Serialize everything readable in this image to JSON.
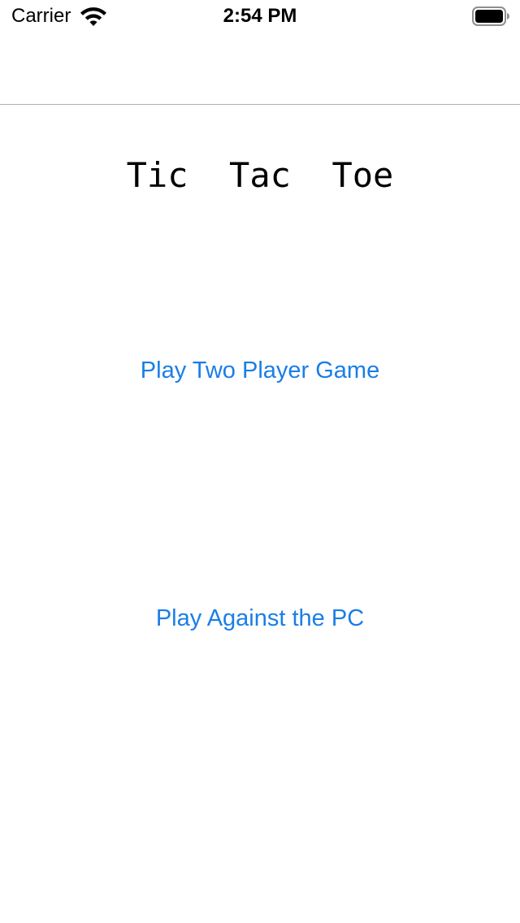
{
  "status_bar": {
    "carrier": "Carrier",
    "time": "2:54 PM",
    "wifi_icon": "wifi-icon",
    "battery_icon": "battery-icon"
  },
  "main": {
    "title": "Tic  Tac  Toe",
    "two_player_label": "Play Two Player Game",
    "vs_pc_label": "Play Against the PC"
  },
  "colors": {
    "link": "#1a7ee6",
    "divider": "#b2b2b2",
    "background": "#ffffff"
  }
}
